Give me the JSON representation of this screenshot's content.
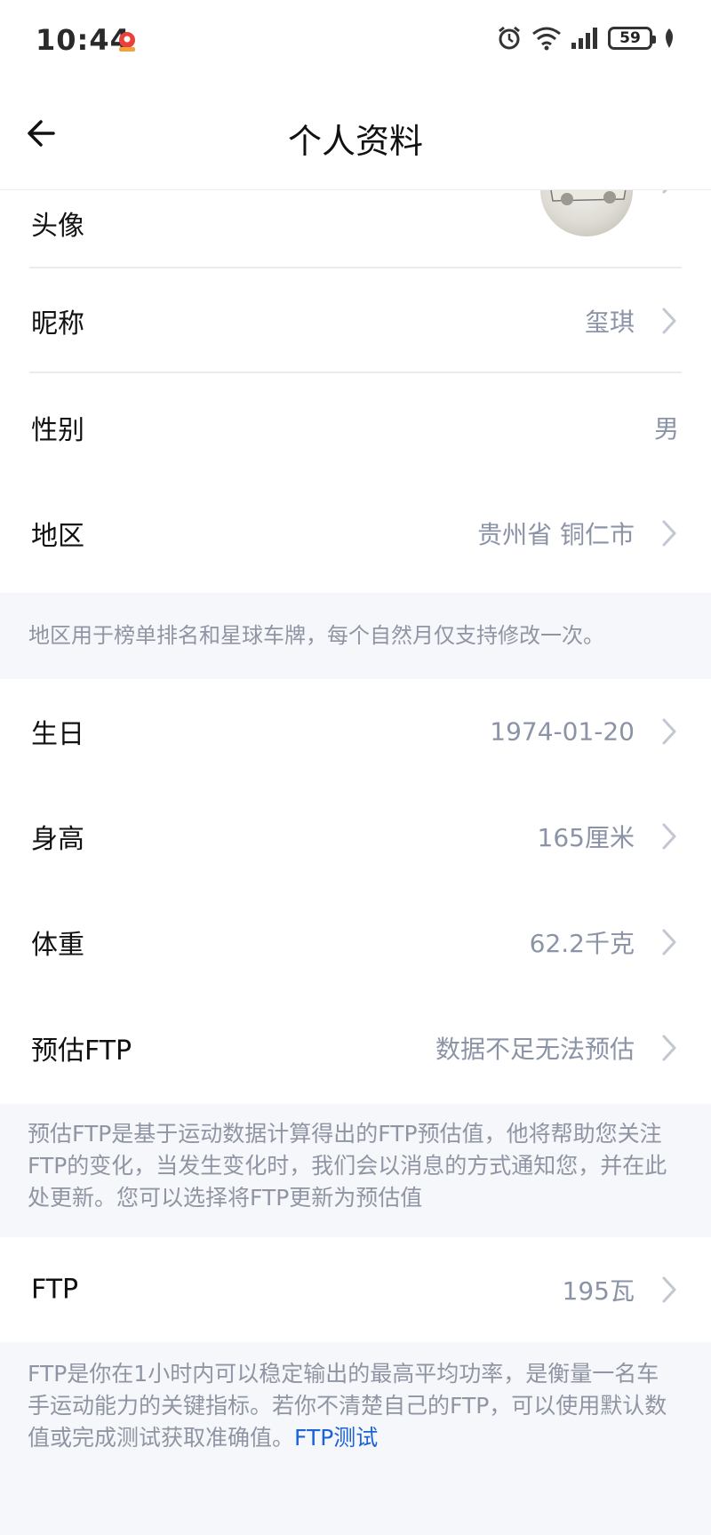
{
  "status_bar": {
    "time": "10:44",
    "battery": "59",
    "icons": [
      "map-pin-app-icon",
      "alarm-icon",
      "wifi-icon",
      "signal-icon",
      "battery-icon",
      "leaf-icon"
    ]
  },
  "header": {
    "title": "个人资料",
    "back_icon": "arrow-left-icon"
  },
  "profile": {
    "avatar_label": "头像",
    "nickname_label": "昵称",
    "nickname_value": "玺琪",
    "gender_label": "性别",
    "gender_value": "男",
    "region_label": "地区",
    "region_value": "贵州省 铜仁市",
    "region_note": "地区用于榜单排名和星球车牌，每个自然月仅支持修改一次。",
    "birthday_label": "生日",
    "birthday_value": "1974-01-20",
    "height_label": "身高",
    "height_value": "165厘米",
    "weight_label": "体重",
    "weight_value": "62.2千克",
    "est_ftp_label": "预估FTP",
    "est_ftp_value": "数据不足无法预估",
    "est_ftp_note": "预估FTP是基于运动数据计算得出的FTP预估值，他将帮助您关注FTP的变化，当发生变化时，我们会以消息的方式通知您，并在此处更新。您可以选择将FTP更新为预估值",
    "ftp_label": "FTP",
    "ftp_value": "195瓦",
    "ftp_note": "FTP是你在1小时内可以稳定输出的最高平均功率，是衡量一名车手运动能力的关键指标。若你不清楚自己的FTP，可以使用默认数值或完成测试获取准确值。",
    "ftp_test_link": "FTP测试"
  },
  "colors": {
    "accent": "#1a63d8",
    "value_text": "#8b93a6",
    "note_bg": "#f6f7fb"
  }
}
